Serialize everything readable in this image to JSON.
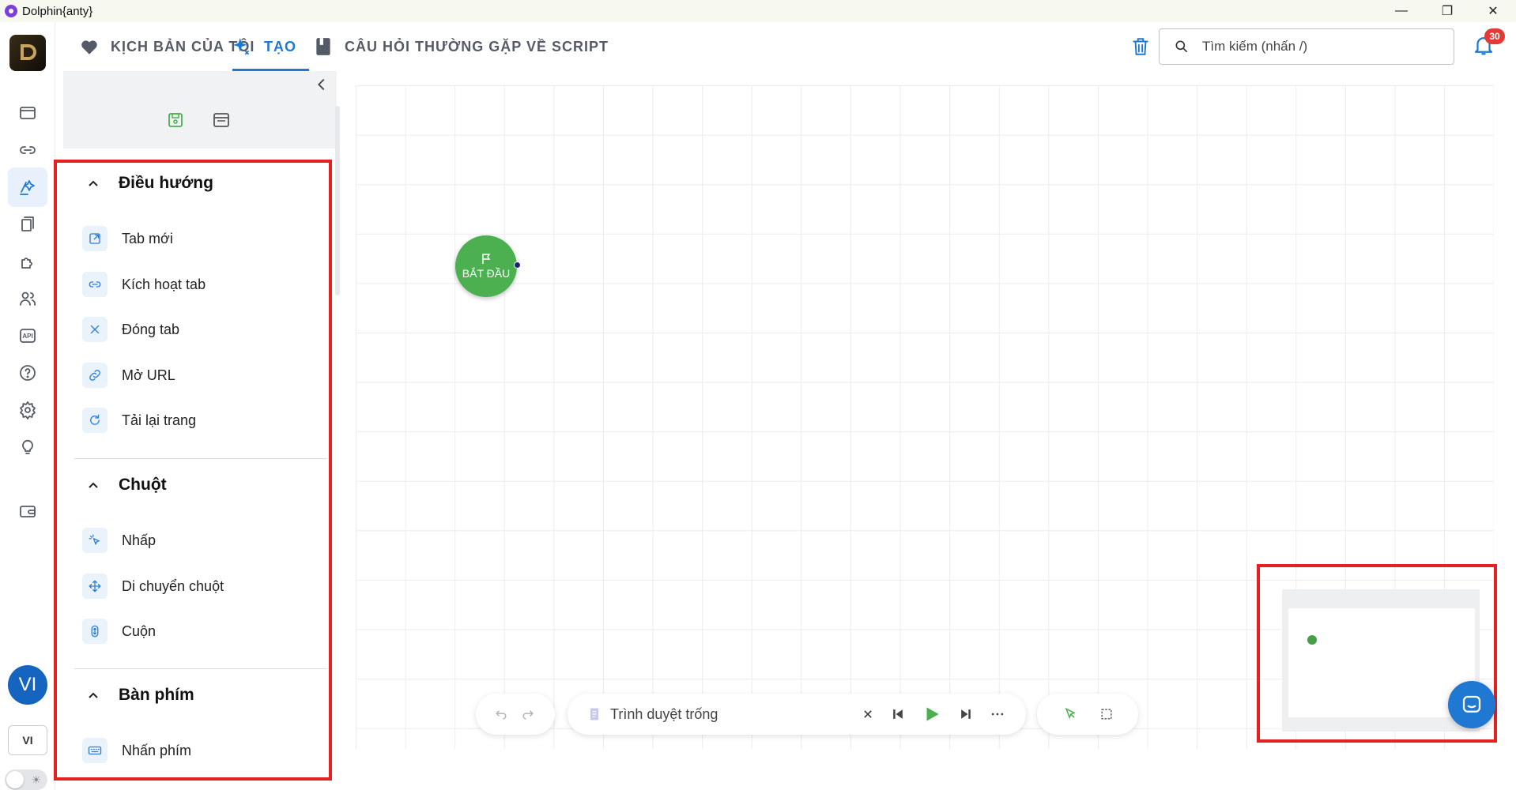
{
  "window": {
    "title": "Dolphin{anty}"
  },
  "topnav": {
    "tabs": [
      {
        "label": "KỊCH BẢN CỦA TÔI",
        "icon": "heart-icon"
      },
      {
        "label": "TẠO",
        "icon": "sparkle-icon"
      },
      {
        "label": "CÂU HỎI THƯỜNG GẶP VỀ SCRIPT",
        "icon": "book-icon"
      }
    ],
    "active_tab": "TẠO",
    "search": {
      "placeholder": "Tìm kiếm (nhấn /)"
    },
    "notifications": {
      "count": "30"
    }
  },
  "rail": {
    "avatar": "VI",
    "language": "VI",
    "api_label": "API"
  },
  "panel": {
    "sections": [
      {
        "title": "Điều hướng",
        "items": [
          "Tab mới",
          "Kích hoạt tab",
          "Đóng tab",
          "Mở URL",
          "Tải lại trang"
        ]
      },
      {
        "title": "Chuột",
        "items": [
          "Nhấp",
          "Di chuyển chuột",
          "Cuộn"
        ]
      },
      {
        "title": "Bàn phím",
        "items": [
          "Nhấn phím"
        ]
      }
    ]
  },
  "canvas": {
    "start_node": {
      "label": "BẮT ĐẦU"
    }
  },
  "toolbar": {
    "browser_label": "Trình duyệt trống"
  },
  "colors": {
    "accent": "#1f78d1",
    "start_node": "#4caf50",
    "highlight_box": "#e22121",
    "badge": "#e53935"
  }
}
